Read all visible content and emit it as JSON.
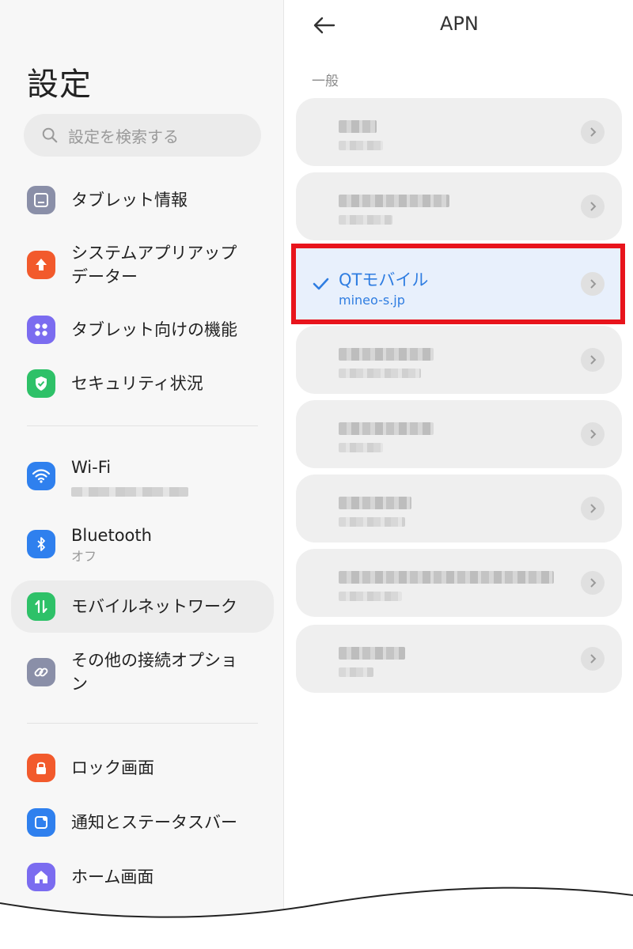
{
  "settings": {
    "title": "設定",
    "search_placeholder": "設定を検索する",
    "items": [
      {
        "label": "タブレット情報",
        "icon": "tablet-icon",
        "color": "#8a8fa8"
      },
      {
        "label": "システムアプリアップデーター",
        "icon": "update-arrow-icon",
        "color": "#f25a2c"
      },
      {
        "label": "タブレット向けの機能",
        "icon": "grid-dots-icon",
        "color": "#7b6cf0"
      },
      {
        "label": "セキュリティ状況",
        "icon": "shield-check-icon",
        "color": "#2ec168"
      },
      {
        "label": "Wi-Fi",
        "icon": "wifi-icon",
        "color": "#2f80ee"
      },
      {
        "label": "Bluetooth",
        "sub": "オフ",
        "icon": "bluetooth-icon",
        "color": "#2f80ee"
      },
      {
        "label": "モバイルネットワーク",
        "icon": "mobile-data-icon",
        "color": "#2ec168"
      },
      {
        "label": "その他の接続オプション",
        "icon": "link-icon",
        "color": "#8a8fa8"
      },
      {
        "label": "ロック画面",
        "icon": "lock-icon",
        "color": "#f25a2c"
      },
      {
        "label": "通知とステータスバー",
        "icon": "notification-icon",
        "color": "#2f80ee"
      },
      {
        "label": "ホーム画面",
        "icon": "home-icon",
        "color": "#7b6cf0"
      }
    ]
  },
  "apn": {
    "title": "APN",
    "section": "一般",
    "selected_name": "QTモバイル",
    "selected_apn": "mineo-s.jp"
  },
  "colors": {
    "accent": "#2f7de1",
    "highlight_frame": "#e8141c"
  }
}
